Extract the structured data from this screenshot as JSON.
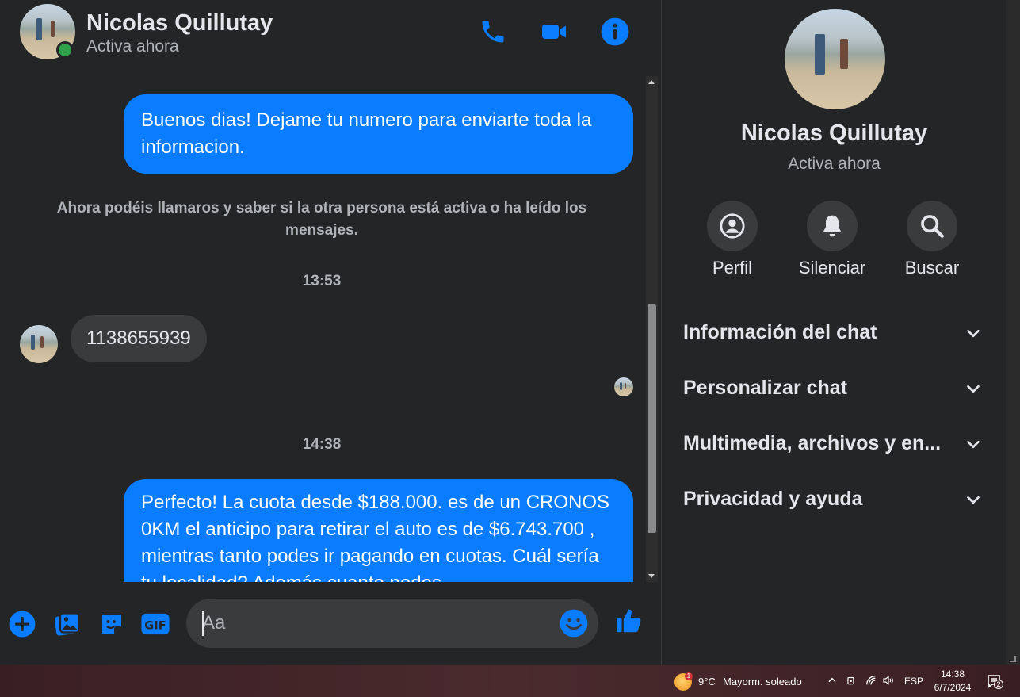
{
  "header": {
    "contact_name": "Nicolas Quillutay",
    "status": "Activa ahora"
  },
  "messages": {
    "outgoing_1": "Buenos dias! Dejame tu numero para enviarte toda la informacion.",
    "system_notice": "Ahora podéis llamaros y saber si la otra persona está activa o ha leído los mensajes.",
    "time_1": "13:53",
    "incoming_1": "1138655939",
    "time_2": "14:38",
    "outgoing_2": "Perfecto! La cuota desde $188.000. es de un CRONOS 0KM el anticipo para retirar el auto es de $6.743.700 , mientras tanto podes ir pagando en cuotas. Cuál sería tu localidad? Además cuanto podes"
  },
  "composer": {
    "placeholder": "Aa"
  },
  "panel": {
    "name": "Nicolas Quillutay",
    "status": "Activa ahora",
    "actions": [
      {
        "label": "Perfil",
        "icon": "profile-icon"
      },
      {
        "label": "Silenciar",
        "icon": "bell-icon"
      },
      {
        "label": "Buscar",
        "icon": "search-icon"
      }
    ],
    "sections": [
      {
        "label": "Información del chat"
      },
      {
        "label": "Personalizar chat"
      },
      {
        "label": "Multimedia, archivos y en..."
      },
      {
        "label": "Privacidad y ayuda"
      }
    ]
  },
  "taskbar": {
    "weather_badge": "1",
    "weather_temp": "9°C",
    "weather_desc": "Mayorm. soleado",
    "language": "ESP",
    "time": "14:38",
    "date": "6/7/2024",
    "notification_count": "2"
  },
  "colors": {
    "accent": "#0a7cff",
    "background": "#242526",
    "bubble_in": "#3a3b3c",
    "online": "#31a24c"
  }
}
